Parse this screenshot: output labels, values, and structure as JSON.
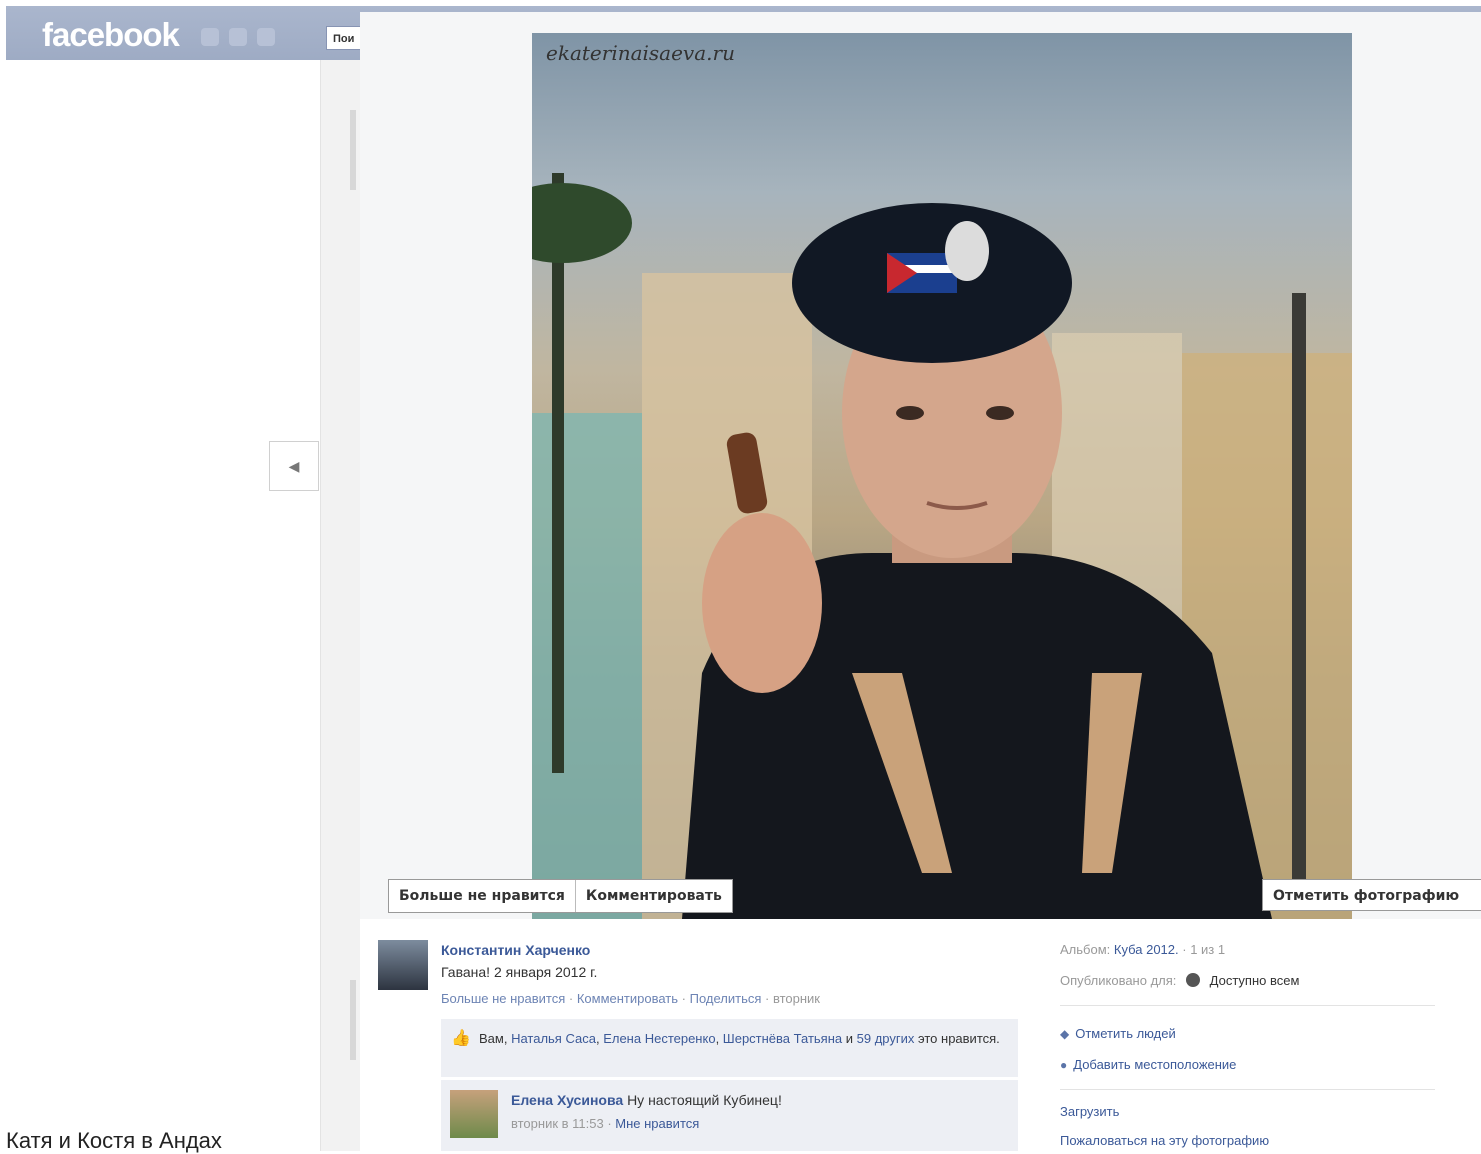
{
  "header": {
    "logo": "facebook",
    "search_fragment": "Пои"
  },
  "page": {
    "bottom_caption": "Катя и Костя в Андах"
  },
  "photo": {
    "watermark": "ekaterinaisaeva.ru"
  },
  "actions": {
    "unlike_label": "Больше не нравится",
    "comment_label": "Комментировать",
    "tag_photo_label": "Отметить фотографию"
  },
  "post": {
    "author": "Константин Харченко",
    "description": "Гавана! 2 января 2012 г.",
    "unlike": "Больше не нравится",
    "comment": "Комментировать",
    "share": "Поделиться",
    "time": "вторник",
    "likes": {
      "prefix": "Вам,",
      "names": [
        "Наталья Саса",
        "Елена Нестеренко",
        "Шерстнёва Татьяна"
      ],
      "and": "и",
      "others": "59 других",
      "suffix": "это нравится."
    },
    "comment_item": {
      "author": "Елена Хусинова",
      "text": "Ну настоящий Кубинец!",
      "time": "вторник в 11:53",
      "like": "Мне нравится"
    }
  },
  "sidebar": {
    "album_label": "Альбом:",
    "album_name": "Куба 2012.",
    "album_count": "1 из 1",
    "published_label": "Опубликовано для:",
    "privacy": "Доступно всем",
    "tag_people": "Отметить людей",
    "add_location": "Добавить местоположение",
    "upload": "Загрузить",
    "report": "Пожаловаться на эту фотографию"
  }
}
